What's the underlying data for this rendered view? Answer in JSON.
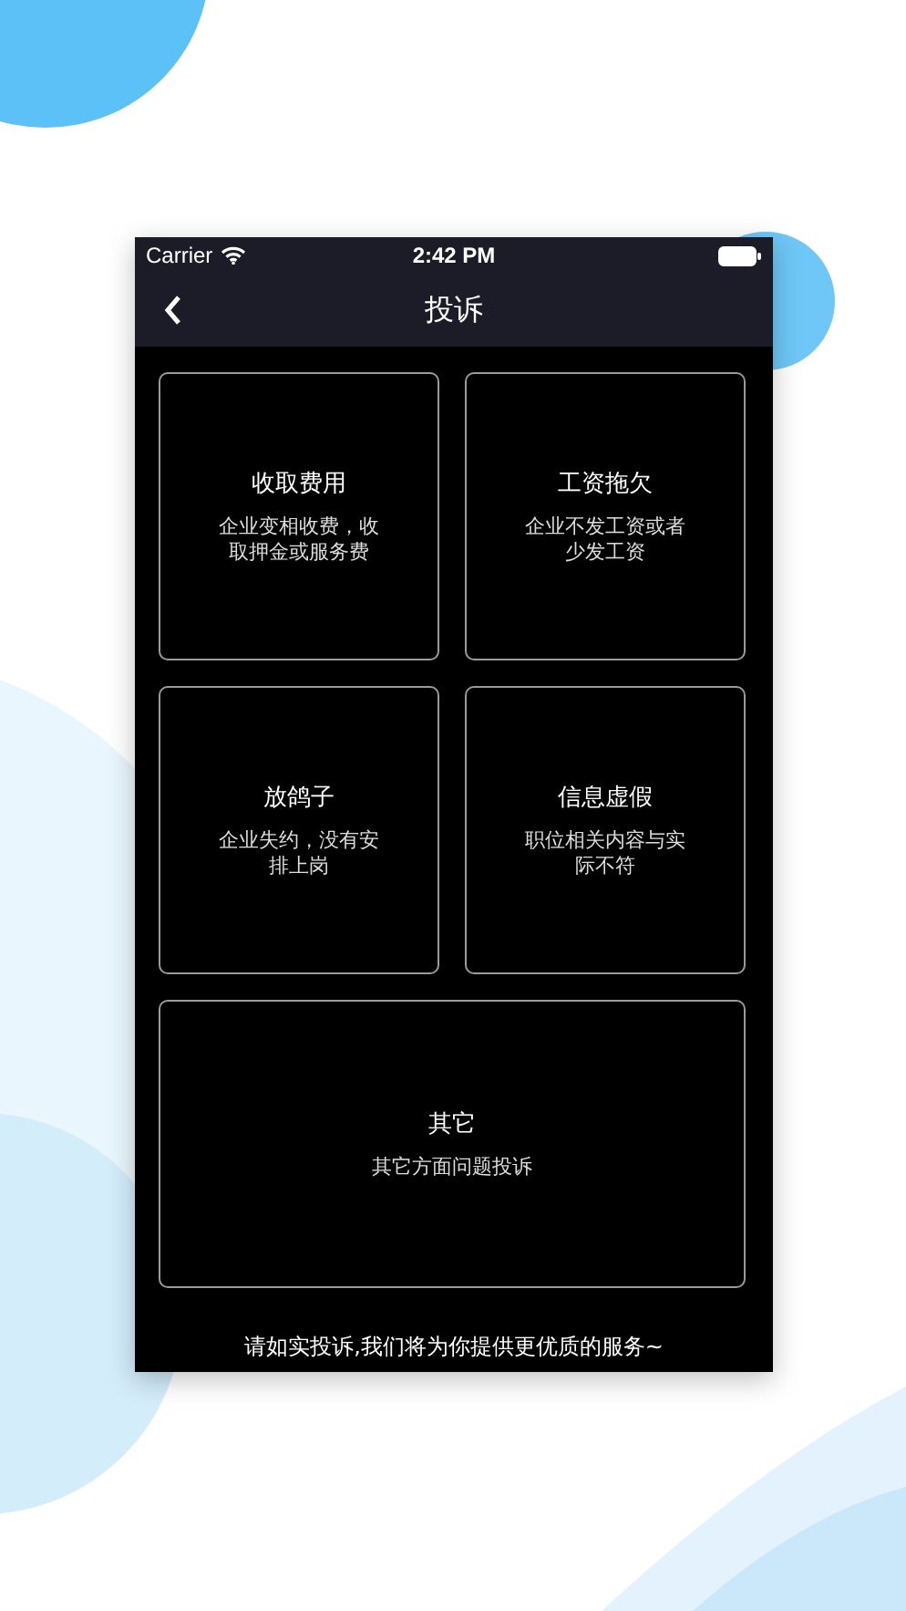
{
  "status_bar": {
    "carrier": "Carrier",
    "time": "2:42 PM"
  },
  "nav": {
    "title": "投诉"
  },
  "cards": [
    {
      "kind": "half",
      "title": "收取费用",
      "description": "企业变相收费，收取押金或服务费"
    },
    {
      "kind": "half",
      "title": "工资拖欠",
      "description": "企业不发工资或者少发工资"
    },
    {
      "kind": "half",
      "title": "放鸽子",
      "description": "企业失约，没有安排上岗"
    },
    {
      "kind": "half",
      "title": "信息虚假",
      "description": "职位相关内容与实际不符"
    },
    {
      "kind": "full",
      "title": "其它",
      "description": "其它方面问题投诉"
    }
  ],
  "footer": "请如实投诉,我们将为你提供更优质的服务~"
}
